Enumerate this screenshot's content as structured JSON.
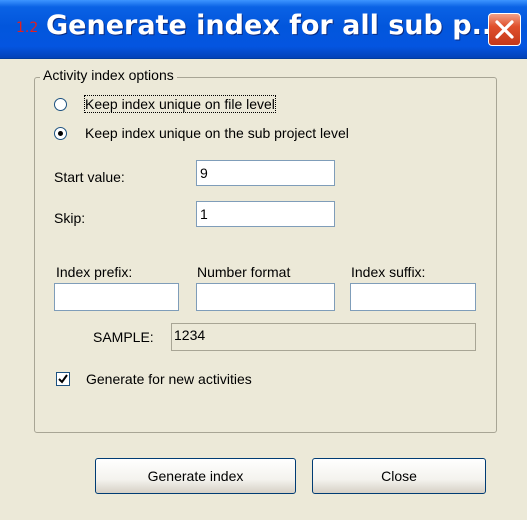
{
  "window": {
    "title": "Generate index for all sub p...",
    "icon_text": "1.2",
    "title_color": "#0256DC",
    "close_color": "#E0502C"
  },
  "group": {
    "legend": "Activity index options",
    "options": [
      {
        "label": "Keep index unique on file level",
        "selected": false
      },
      {
        "label": "Keep index unique on the sub project level",
        "selected": true
      }
    ],
    "start_value_label": "Start value:",
    "start_value": "9",
    "skip_label": "Skip:",
    "skip_value": "1",
    "index_prefix_label": "Index prefix:",
    "index_prefix_value": "",
    "number_format_label": "Number format",
    "number_format_value": "",
    "index_suffix_label": "Index suffix:",
    "index_suffix_value": "",
    "sample_label": "SAMPLE:",
    "sample_value": "1234",
    "generate_new_label": "Generate for new activities",
    "generate_new_checked": true
  },
  "buttons": {
    "generate": "Generate index",
    "close": "Close"
  },
  "icons": {
    "close": "close-icon",
    "check": "checkmark-icon",
    "app": "app-icon"
  }
}
